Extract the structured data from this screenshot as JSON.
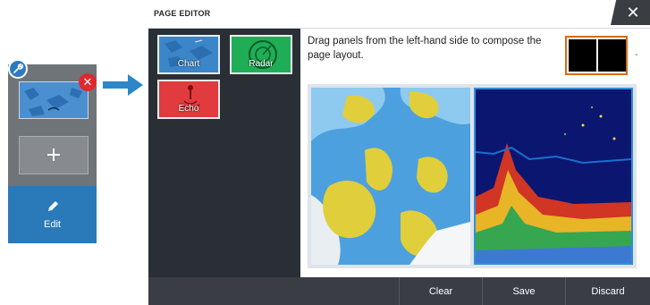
{
  "mini_panel": {
    "edit_label": "Edit",
    "plus_symbol": "+",
    "icons": [
      "wrench-icon",
      "close-icon",
      "plus-icon",
      "pencil-icon"
    ]
  },
  "editor": {
    "title": "PAGE EDITOR",
    "close_symbol": "✕",
    "instruction": "Drag panels from the left-hand side to compose the page layout.",
    "panels": [
      {
        "label": "Chart",
        "color": "#3b86c9"
      },
      {
        "label": "Radar",
        "color": "#1fae55"
      },
      {
        "label": "Echo",
        "color": "#e23b3f"
      }
    ],
    "layout_caret": "-",
    "footer": {
      "clear": "Clear",
      "save": "Save",
      "discard": "Discard"
    }
  },
  "colors": {
    "accent_blue": "#2a79b8",
    "close_red": "#e0282e",
    "layout_border": "#d86b17"
  }
}
